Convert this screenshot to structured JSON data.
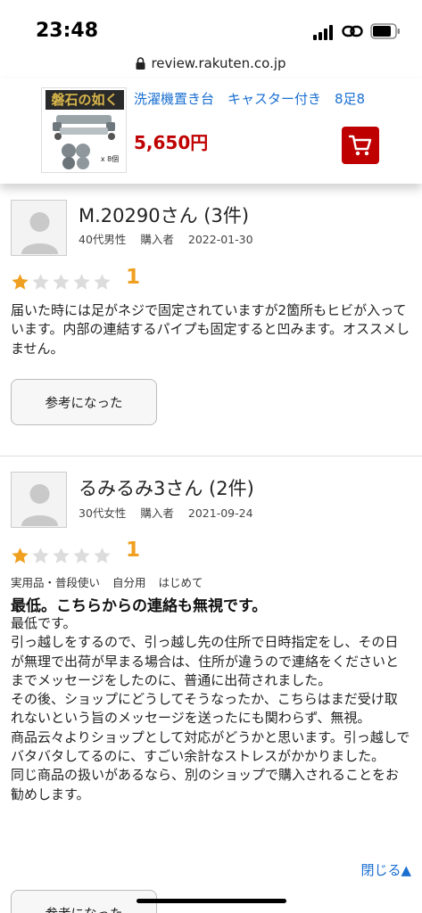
{
  "status_bar": {
    "time": "23:48"
  },
  "browser": {
    "url": "review.rakuten.co.jp"
  },
  "product": {
    "title": "洗濯機置き台　キャスター付き　8足8",
    "price": "5,650円",
    "image_caption": "磐石の如く",
    "image_sub": "x 8個",
    "accent_color": "#bf0000"
  },
  "reviews": [
    {
      "name": "M.20290さん (3件)",
      "demographic": "40代男性",
      "buyer_label": "購入者",
      "date": "2022-01-30",
      "rating": 1,
      "rating_label": "1",
      "body": [
        "届いた時には足がネジで固定されていますが2箇所もヒビが入っています。内部の連結するパイプも固定すると凹みます。オススメしません。"
      ],
      "helpful_label": "参考になった"
    },
    {
      "name": "るみるみ3さん (2件)",
      "demographic": "30代女性",
      "buyer_label": "購入者",
      "date": "2021-09-24",
      "rating": 1,
      "rating_label": "1",
      "usage": [
        "実用品・普段使い",
        "自分用",
        "はじめて"
      ],
      "title": "最低。こちらからの連絡も無視です。",
      "body": [
        "最低です。",
        "引っ越しをするので、引っ越し先の住所で日時指定をし、その日が無理で出荷が早まる場合は、住所が違うので連絡をくださいとまでメッセージをしたのに、普通に出荷されました。",
        "その後、ショップにどうしてそうなったか、こちらはまだ受け取れないという旨のメッセージを送ったにも関わらず、無視。",
        "商品云々よりショップとして対応がどうかと思います。引っ越しでバタバタしてるのに、すごい余計なストレスがかかりました。",
        "同じ商品の扱いがあるなら、別のショップで購入されることをお勧めします。"
      ],
      "close_label": "閉じる▲",
      "helpful_label": "参考になった"
    }
  ]
}
